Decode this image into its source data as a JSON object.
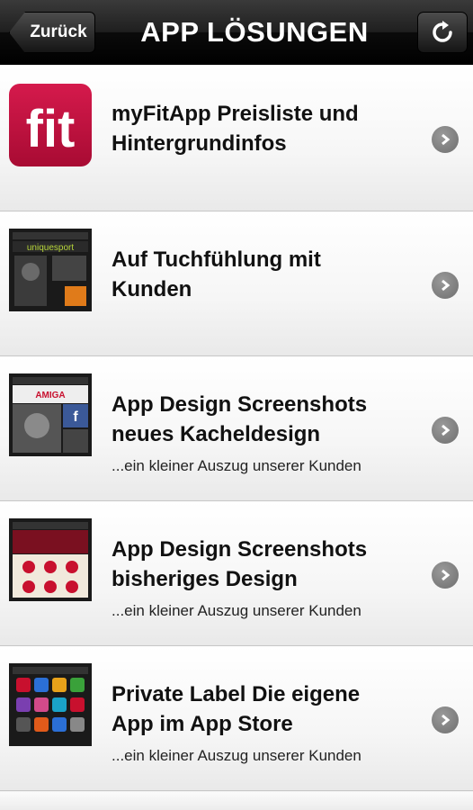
{
  "navbar": {
    "back_label": "Zurück",
    "title": "APP LÖSUNGEN"
  },
  "items": [
    {
      "title_line1": "myFitApp Preisliste und",
      "title_line2": "Hintergrundinfos",
      "subtitle": "",
      "thumb_icon": "fit-logo-icon",
      "thumb_text": "fit"
    },
    {
      "title_line1": "Auf Tuchfühlung mit",
      "title_line2": "Kunden",
      "subtitle": "",
      "thumb_icon": "uniquesport-app-screenshot-icon",
      "thumb_text": "uniquesport"
    },
    {
      "title_line1": "App Design Screenshots",
      "title_line2": "neues Kacheldesign",
      "subtitle": "...ein kleiner Auszug unserer Kunden",
      "thumb_icon": "amiga-app-screenshot-icon",
      "thumb_text": "AMIGA"
    },
    {
      "title_line1": "App Design Screenshots",
      "title_line2": "bisheriges Design",
      "subtitle": "...ein kleiner Auszug unserer Kunden",
      "thumb_icon": "old-design-app-screenshot-icon",
      "thumb_text": ""
    },
    {
      "title_line1": "Private Label Die eigene",
      "title_line2": "App im App Store",
      "subtitle": "...ein kleiner Auszug unserer Kunden",
      "thumb_icon": "app-store-screenshot-icon",
      "thumb_text": ""
    }
  ],
  "colors": {
    "fit_brand": "#c4103f",
    "chevron": "#7a7a7a"
  }
}
